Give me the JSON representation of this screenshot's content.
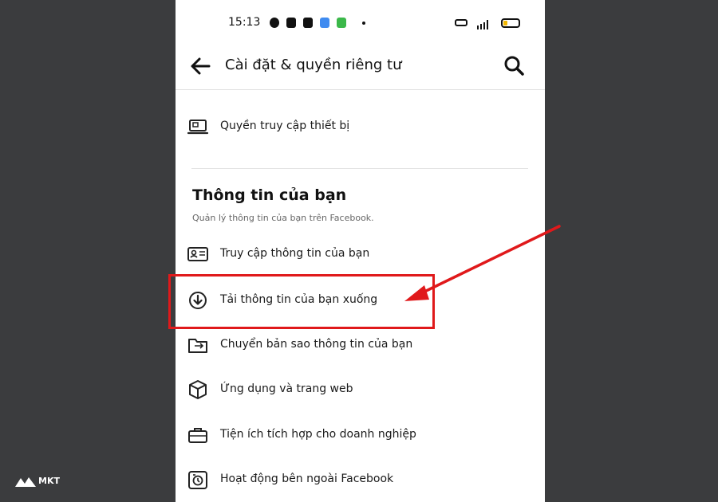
{
  "status_bar": {
    "time": "15:13"
  },
  "header": {
    "title": "Cài đặt & quyền riêng tư",
    "back_icon": "arrow-left-icon",
    "search_icon": "search-icon"
  },
  "top_item": {
    "label": "Quyền truy cập thiết bị",
    "icon": "laptop-icon"
  },
  "section": {
    "title": "Thông tin của bạn",
    "subtitle": "Quản lý thông tin của bạn trên Facebook."
  },
  "items": [
    {
      "label": "Truy cập thông tin của bạn",
      "icon": "id-card-icon"
    },
    {
      "label": "Tải thông tin của bạn xuống",
      "icon": "download-icon"
    },
    {
      "label": "Chuyển bản sao thông tin của bạn",
      "icon": "folder-transfer-icon"
    },
    {
      "label": "Ứng dụng và trang web",
      "icon": "cube-icon"
    },
    {
      "label": "Tiện ích tích hợp cho doanh nghiệp",
      "icon": "briefcase-icon"
    },
    {
      "label": "Hoạt động bên ngoài Facebook",
      "icon": "activity-clock-icon"
    }
  ],
  "watermark": {
    "text": "MKT"
  },
  "colors": {
    "highlight": "#e0191b",
    "background": "#3b3c3e"
  }
}
